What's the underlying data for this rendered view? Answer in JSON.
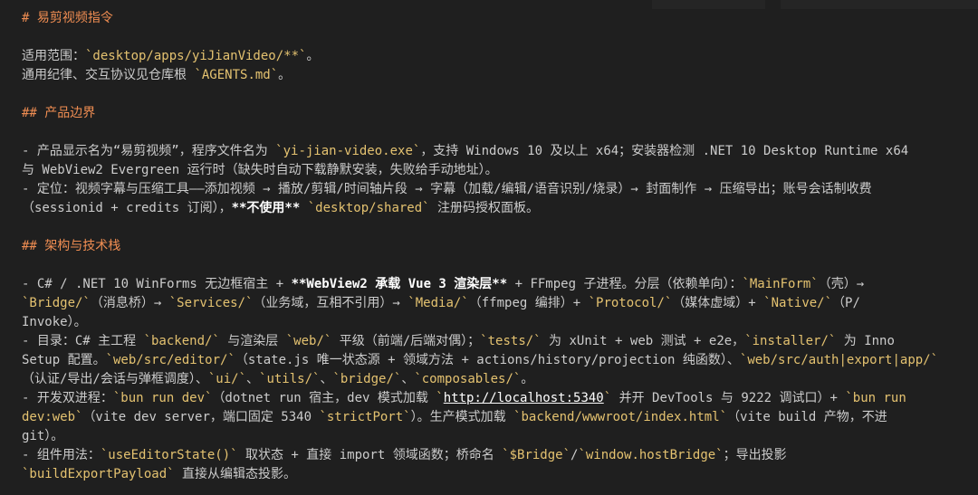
{
  "doc": {
    "h1": "# 易剪视频指令",
    "scope_prefix": "适用范围：",
    "scope_path": "`desktop/apps/yiJianVideo/**`",
    "scope_suffix": "。",
    "common_prefix": "通用纪律、交互协议见仓库根 ",
    "common_file": "`AGENTS.md`",
    "common_suffix": "。",
    "h2_product": "## 产品边界",
    "p1_a": "- 产品显示名为“易剪视频”，程序文件名为 ",
    "p1_exe": "`yi-jian-video.exe`",
    "p1_b": "，支持 Windows 10 及以上 x64；安装器检测 .NET 10 Desktop Runtime x64",
    "p1_c": "与 WebView2 Evergreen 运行时（缺失时自动下载静默安装，失败给手动地址）。",
    "p2_a": "- 定位：视频字幕与压缩工具——添加视频 → 播放/剪辑/时间轴片段 → 字幕（加载/编辑/语音识别/烧录）→ 封面制作 → 压缩导出；账号会话制收费",
    "p2_b": "（sessionid + credits 订阅），",
    "p2_bold": "**不使用**",
    "p2_c": " ",
    "p2_code": "`desktop/shared`",
    "p2_d": " 注册码授权面板。",
    "h2_arch": "## 架构与技术栈",
    "a1_a": "- C# / .NET 10 WinForms 无边框宿主 + ",
    "a1_bold": "**WebView2 承载 Vue 3 渲染层**",
    "a1_b": " + FFmpeg 子进程。分层（依赖单向）：",
    "a1_mainform": "`MainForm`",
    "a1_c": "（壳）→",
    "a2_bridge": "`Bridge/`",
    "a2_a": "（消息桥）→ ",
    "a2_services": "`Services/`",
    "a2_b": "（业务域，互相不引用）→ ",
    "a2_media": "`Media/`",
    "a2_c": "（ffmpeg 编排）+ ",
    "a2_protocol": "`Protocol/`",
    "a2_d": "（媒体虚域）+ ",
    "a2_native": "`Native/`",
    "a2_e": "（P/",
    "a3": "Invoke）。",
    "b1_a": "- 目录：C# 主工程 ",
    "b1_backend": "`backend/`",
    "b1_b": " 与渲染层 ",
    "b1_web": "`web/`",
    "b1_c": " 平级（前端/后端对偶）；",
    "b1_tests": "`tests/`",
    "b1_d": " 为 xUnit + web 测试 + e2e，",
    "b1_installer": "`installer/`",
    "b1_e": " 为 Inno",
    "b2_a": "Setup 配置。",
    "b2_editor": "`web/src/editor/`",
    "b2_b": "（state.js 唯一状态源 + 领域方法 + actions/history/projection 纯函数）、",
    "b2_auth": "`web/src/auth|export|app/`",
    "b3_a": "（认证/导出/会话与弹框调度）、",
    "b3_ui": "`ui/`",
    "b3_sep1": "、",
    "b3_utils": "`utils/`",
    "b3_sep2": "、",
    "b3_bridge": "`bridge/`",
    "b3_sep3": "、",
    "b3_composables": "`composables/`",
    "b3_end": "。",
    "c1_a": "- 开发双进程：",
    "c1_dev": "`bun run dev`",
    "c1_b": "（dotnet run 宿主，dev 模式加载 ",
    "c1_tick1": "`",
    "c1_url": "http://localhost:5340",
    "c1_tick2": "`",
    "c1_c": " 并开 DevTools 与 9222 调试口）+ ",
    "c1_bunrun": "`bun run",
    "c2_devweb": "dev:web`",
    "c2_a": "（vite dev server，端口固定 5340 ",
    "c2_strict": "`strictPort`",
    "c2_b": "）。生产模式加载 ",
    "c2_index": "`backend/wwwroot/index.html`",
    "c2_c": "（vite build 产物，不进",
    "c3": "git）。",
    "d1_a": "- 组件用法：",
    "d1_use": "`useEditorState()`",
    "d1_b": " 取状态 + 直接 import 领域函数；桥命名 ",
    "d1_bridge": "`$Bridge`",
    "d1_slash": "/",
    "d1_host": "`window.hostBridge`",
    "d1_c": "；导出投影",
    "d2_build": "`buildExportPayload`",
    "d2_a": " 直接从编辑态投影。"
  }
}
